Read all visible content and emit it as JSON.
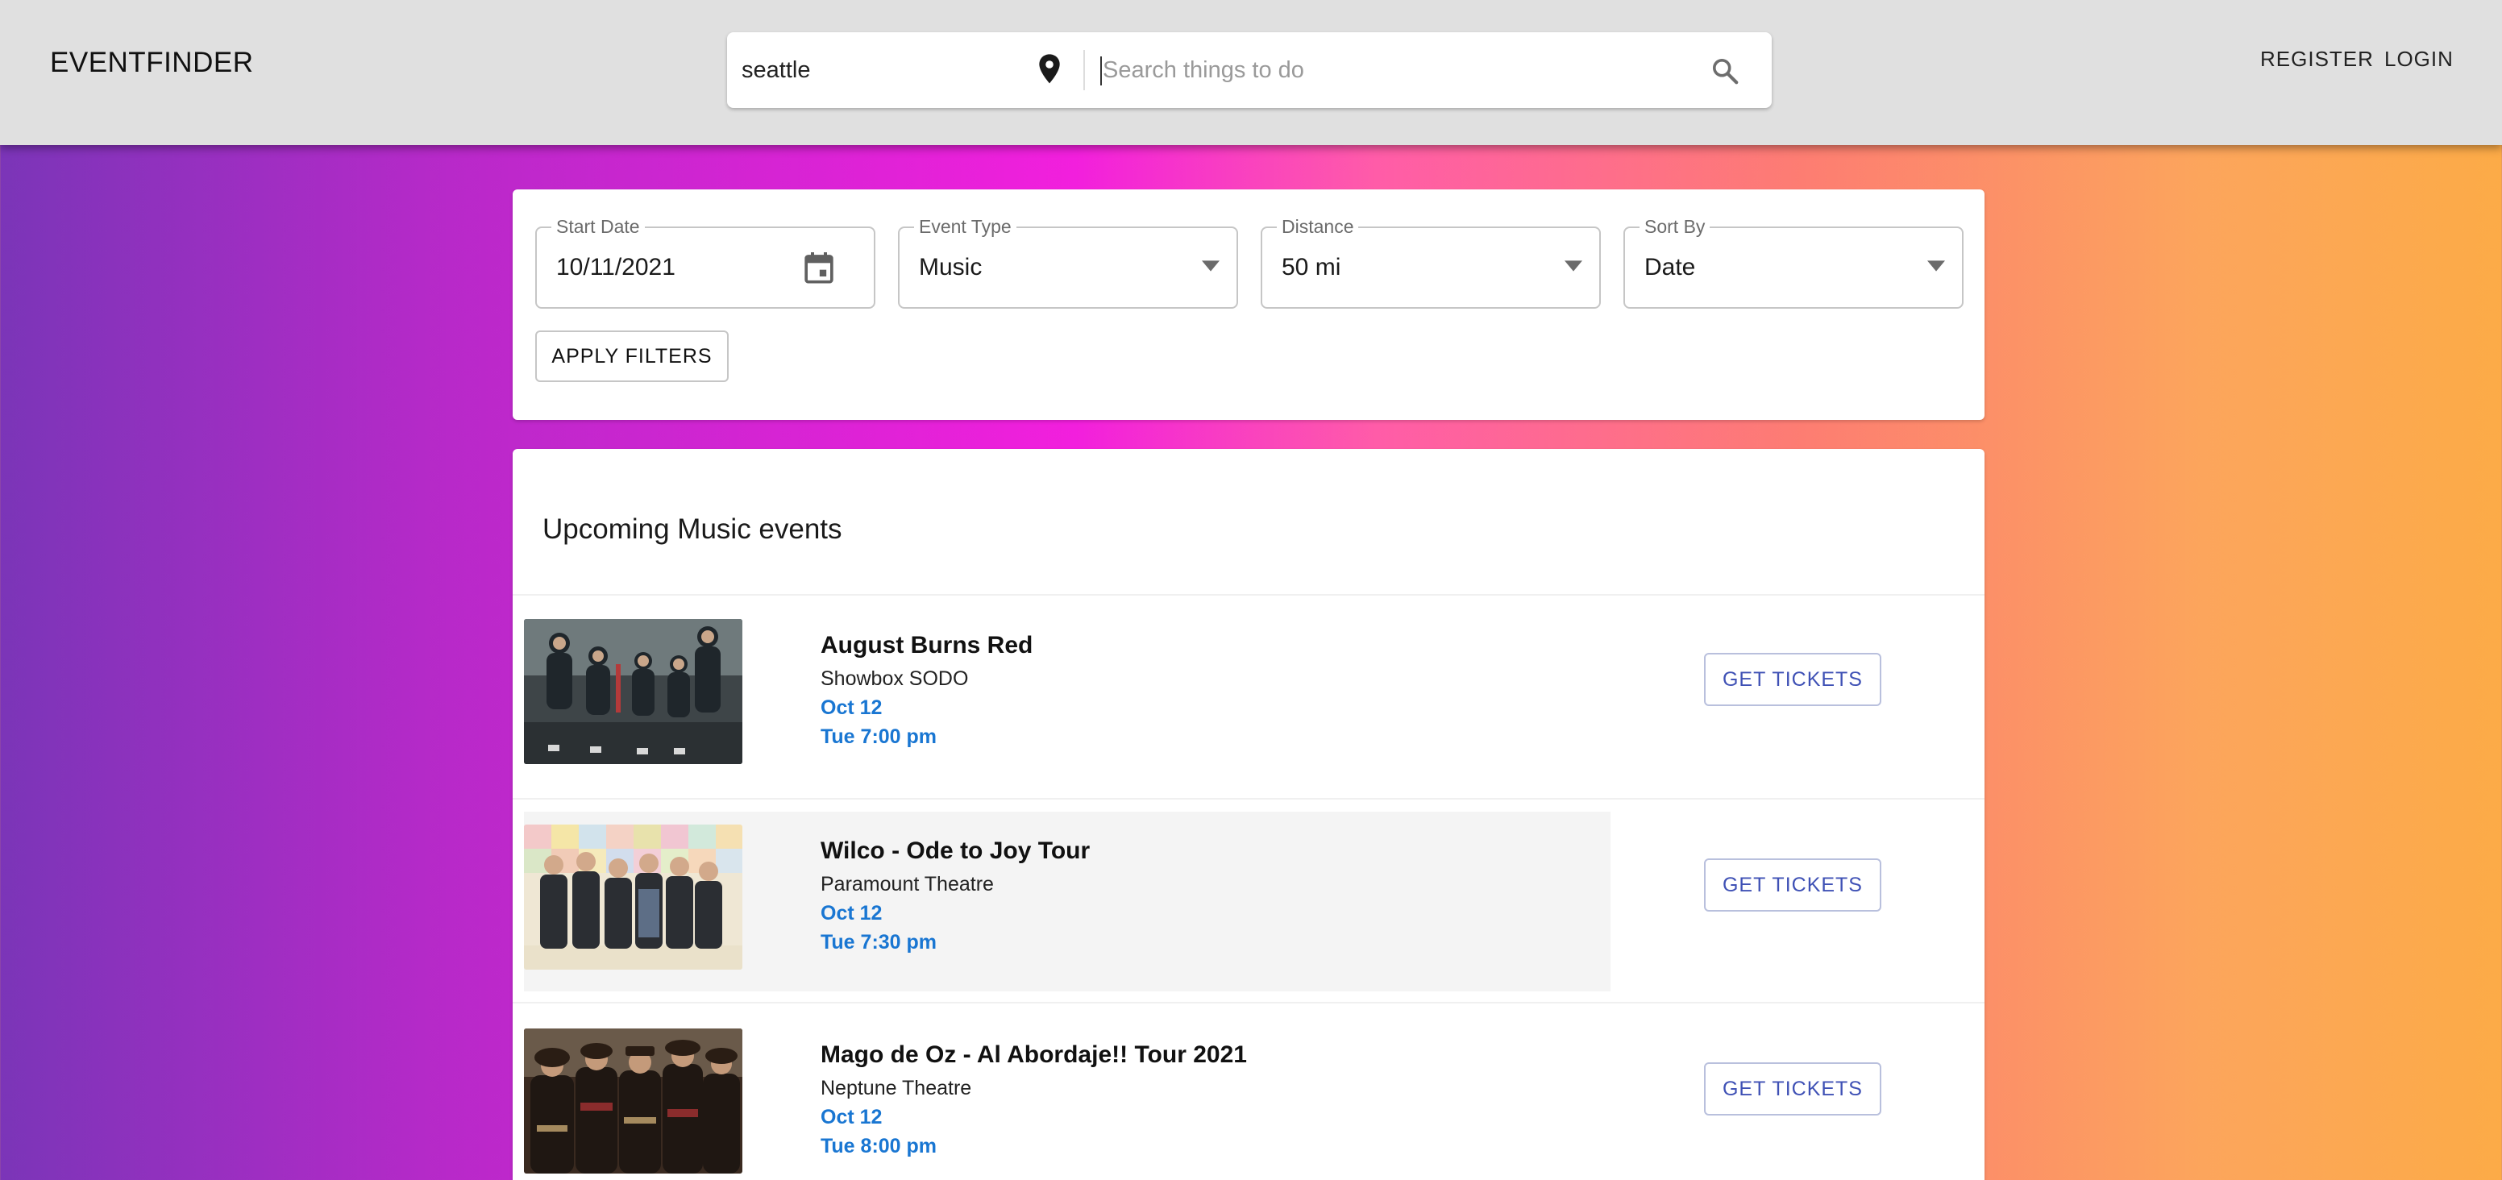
{
  "header": {
    "brand": "EVENTFINDER",
    "location_value": "seattle",
    "search_placeholder": "Search things to do",
    "register_label": "REGISTER",
    "login_label": "LOGIN"
  },
  "filters": {
    "start_date": {
      "label": "Start Date",
      "value": "10/11/2021"
    },
    "event_type": {
      "label": "Event Type",
      "value": "Music"
    },
    "distance": {
      "label": "Distance",
      "value": "50 mi"
    },
    "sort_by": {
      "label": "Sort By",
      "value": "Date"
    },
    "apply_label": "APPLY FILTERS"
  },
  "events": {
    "heading": "Upcoming Music events",
    "items": [
      {
        "title": "August Burns Red",
        "venue": "Showbox SODO",
        "date": "Oct 12",
        "time": "Tue 7:00 pm",
        "button": "GET TICKETS"
      },
      {
        "title": "Wilco - Ode to Joy Tour",
        "venue": "Paramount Theatre",
        "date": "Oct 12",
        "time": "Tue 7:30 pm",
        "button": "GET TICKETS"
      },
      {
        "title": "Mago de Oz - Al Abordaje!! Tour 2021",
        "venue": "Neptune Theatre",
        "date": "Oct 12",
        "time": "Tue 8:00 pm",
        "button": "GET TICKETS"
      }
    ]
  },
  "colors": {
    "link_blue": "#1976d2",
    "button_text": "#3f51b5",
    "appbar": "#e0e0e0"
  },
  "icons": [
    "location-pin-icon",
    "search-icon",
    "calendar-icon",
    "dropdown-arrow-icon"
  ]
}
